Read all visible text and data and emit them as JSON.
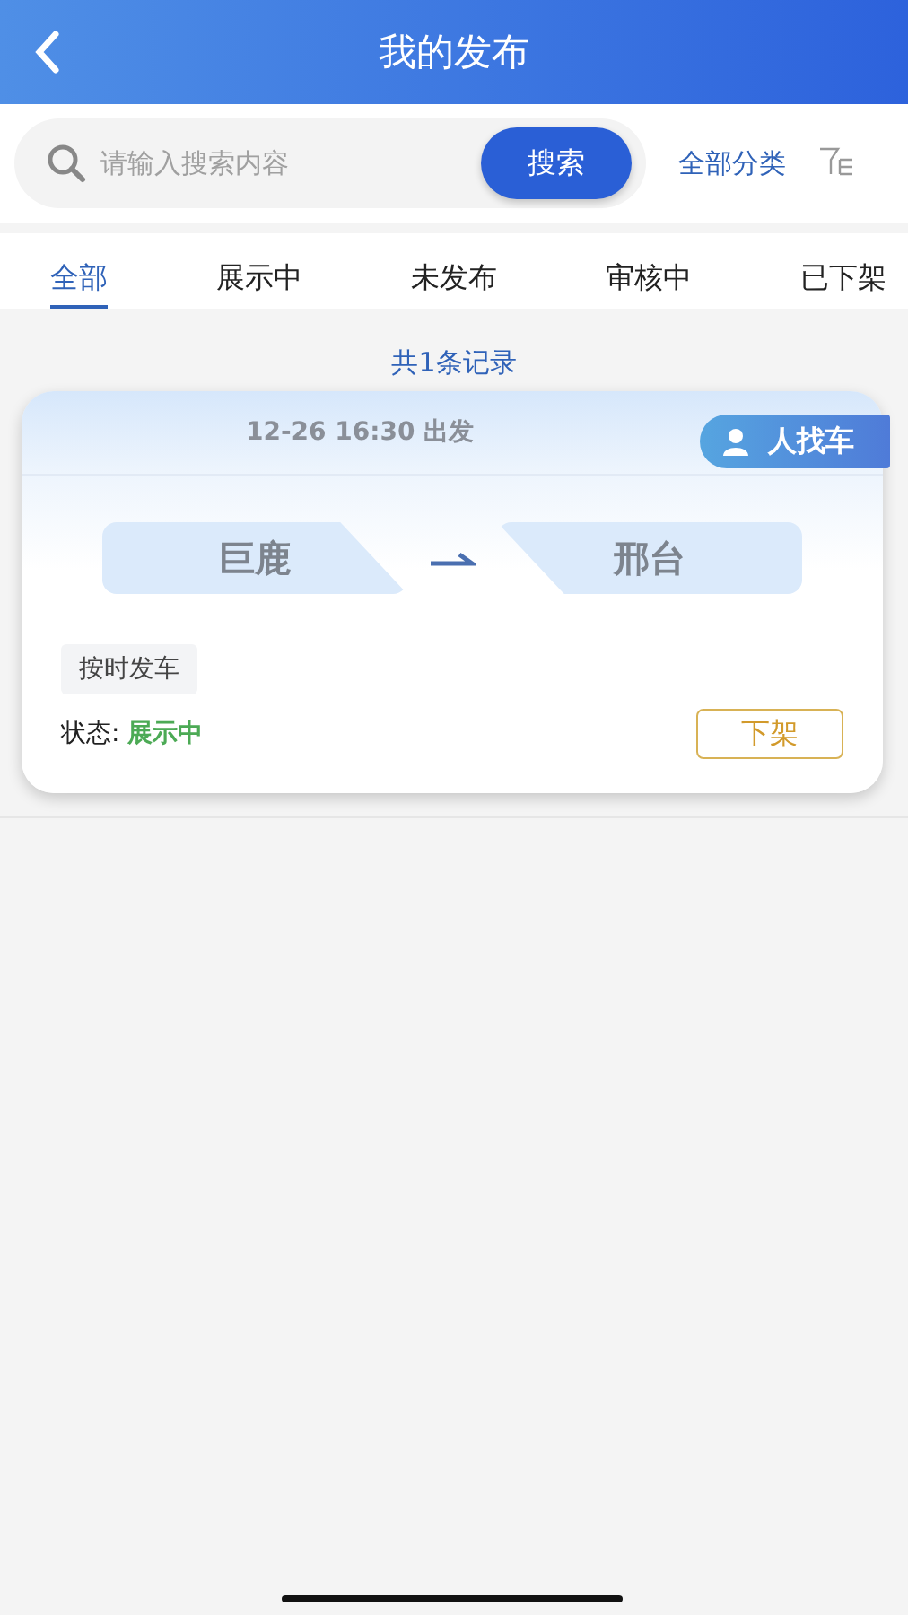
{
  "header": {
    "title": "我的发布"
  },
  "search": {
    "placeholder": "请输入搜索内容",
    "button": "搜索",
    "category": "全部分类"
  },
  "tabs": [
    {
      "label": "全部",
      "selected": true
    },
    {
      "label": "展示中",
      "selected": false
    },
    {
      "label": "未发布",
      "selected": false
    },
    {
      "label": "审核中",
      "selected": false
    },
    {
      "label": "已下架",
      "selected": false
    }
  ],
  "record_count": "共1条记录",
  "posts": [
    {
      "departure": "12-26 16:30 出发",
      "badge": "人找车",
      "from": "巨鹿",
      "to": "邢台",
      "tag": "按时发车",
      "status_label": "状态:",
      "status": "展示中",
      "action": "下架"
    }
  ]
}
